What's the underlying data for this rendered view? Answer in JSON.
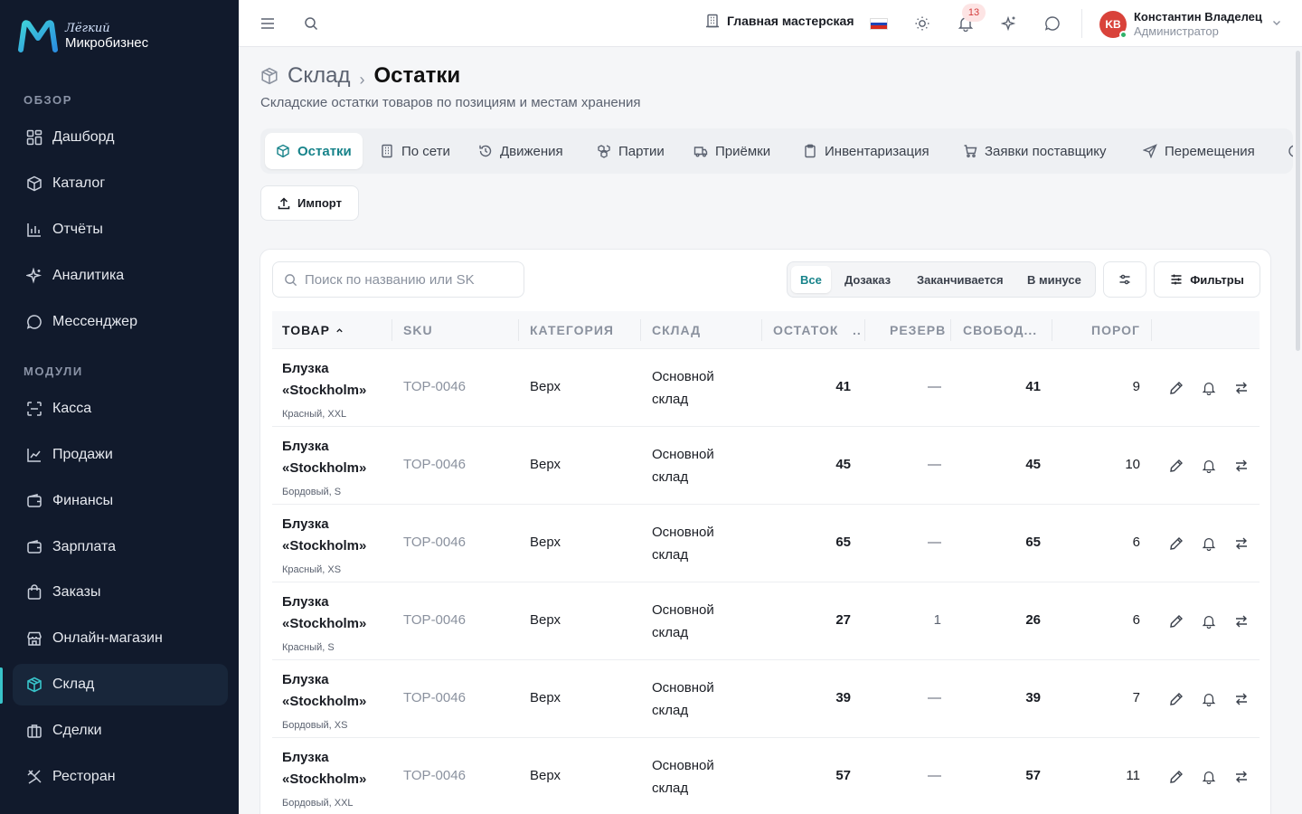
{
  "brand": {
    "line1": "Лёгкий",
    "line2": "Микробизнес"
  },
  "sidebar": {
    "sections": [
      {
        "title": "ОБЗОР"
      },
      {
        "title": "МОДУЛИ"
      }
    ],
    "items": [
      {
        "label": "Дашборд",
        "icon": "dashboard-icon"
      },
      {
        "label": "Каталог",
        "icon": "catalog-icon"
      },
      {
        "label": "Отчёты",
        "icon": "reports-icon"
      },
      {
        "label": "Аналитика",
        "icon": "sparkle-icon"
      },
      {
        "label": "Мессенджер",
        "icon": "chat-icon"
      },
      {
        "label": "Касса",
        "icon": "scan-icon"
      },
      {
        "label": "Продажи",
        "icon": "chart-line-icon"
      },
      {
        "label": "Финансы",
        "icon": "wallet-icon"
      },
      {
        "label": "Зарплата",
        "icon": "wallet-icon"
      },
      {
        "label": "Заказы",
        "icon": "bag-icon"
      },
      {
        "label": "Онлайн-магазин",
        "icon": "store-icon"
      },
      {
        "label": "Склад",
        "icon": "box-icon",
        "active": true
      },
      {
        "label": "Сделки",
        "icon": "briefcase-icon"
      },
      {
        "label": "Ресторан",
        "icon": "utensils-icon"
      }
    ]
  },
  "topbar": {
    "workshop": "Главная мастерская",
    "notifications_count": "13",
    "user": {
      "initials": "KB",
      "name": "Константин Владелец",
      "role": "Администратор"
    }
  },
  "header": {
    "crumb_parent": "Склад",
    "crumb_current": "Остатки",
    "subtitle": "Складские остатки товаров по позициям и местам хранения"
  },
  "tabs": [
    {
      "label": "Остатки",
      "active": true
    },
    {
      "label": "По сети"
    },
    {
      "label": "Движения"
    },
    {
      "label": "Партии"
    },
    {
      "label": "Приёмки"
    },
    {
      "label": "Инвентаризация"
    },
    {
      "label": "Заявки поставщику"
    },
    {
      "label": "Перемещения"
    }
  ],
  "toolbar": {
    "import_label": "Импорт",
    "search_placeholder": "Поиск по названию или SK",
    "segments": [
      {
        "label": "Все",
        "active": true
      },
      {
        "label": "Дозаказ"
      },
      {
        "label": "Заканчивается"
      },
      {
        "label": "В минусе"
      }
    ],
    "filters_label": "Фильтры"
  },
  "table": {
    "columns": [
      "ТОВАР",
      "SKU",
      "КАТЕГОРИЯ",
      "СКЛАД",
      "ОСТАТОК",
      "РЕЗЕРВ",
      "СВОБОД...",
      "ПОРОГ"
    ],
    "rows": [
      {
        "name": "Блузка «Stockholm»",
        "variant": "Красный, XXL",
        "sku": "TOP-0046",
        "category": "Верх",
        "warehouse": "Основной склад",
        "qty": "41",
        "reserve": "—",
        "free": "41",
        "threshold": "9"
      },
      {
        "name": "Блузка «Stockholm»",
        "variant": "Бордовый, S",
        "sku": "TOP-0046",
        "category": "Верх",
        "warehouse": "Основной склад",
        "qty": "45",
        "reserve": "—",
        "free": "45",
        "threshold": "10"
      },
      {
        "name": "Блузка «Stockholm»",
        "variant": "Красный, XS",
        "sku": "TOP-0046",
        "category": "Верх",
        "warehouse": "Основной склад",
        "qty": "65",
        "reserve": "—",
        "free": "65",
        "threshold": "6"
      },
      {
        "name": "Блузка «Stockholm»",
        "variant": "Красный, S",
        "sku": "TOP-0046",
        "category": "Верх",
        "warehouse": "Основной склад",
        "qty": "27",
        "reserve": "1",
        "free": "26",
        "threshold": "6"
      },
      {
        "name": "Блузка «Stockholm»",
        "variant": "Бордовый, XS",
        "sku": "TOP-0046",
        "category": "Верх",
        "warehouse": "Основной склад",
        "qty": "39",
        "reserve": "—",
        "free": "39",
        "threshold": "7"
      },
      {
        "name": "Блузка «Stockholm»",
        "variant": "Бордовый, XXL",
        "sku": "TOP-0046",
        "category": "Верх",
        "warehouse": "Основной склад",
        "qty": "57",
        "reserve": "—",
        "free": "57",
        "threshold": "11"
      }
    ]
  },
  "colors": {
    "sidebar_bg": "#111a2c",
    "accent": "#17838a",
    "accent_light": "#38c3c9",
    "danger": "#d9423a"
  }
}
